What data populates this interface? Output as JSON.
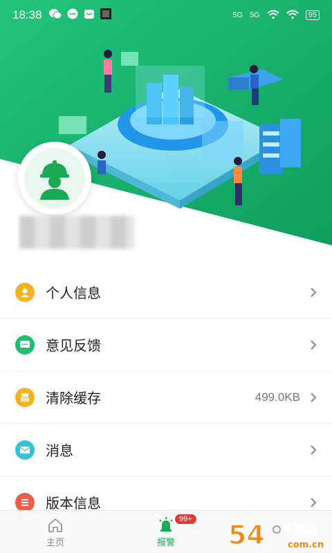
{
  "status_bar": {
    "time": "18:38",
    "signal1": "5G",
    "signal2": "5G",
    "battery": "95"
  },
  "menu": {
    "items": [
      {
        "label": "个人信息",
        "icon": "person-icon",
        "color": "#f5b324"
      },
      {
        "label": "意见反馈",
        "icon": "chat-bubble-icon",
        "color": "#1fbf6b"
      },
      {
        "label": "清除缓存",
        "icon": "broom-icon",
        "color": "#f5b324",
        "value": "499.0KB"
      },
      {
        "label": "消息",
        "icon": "mail-icon",
        "color": "#36c3d9"
      },
      {
        "label": "版本信息",
        "icon": "list-icon",
        "color": "#ef5b4f"
      }
    ]
  },
  "tabbar": {
    "home_label": "主页",
    "alarm_label": "报警",
    "alarm_badge": "99+"
  },
  "watermark": {
    "text1": "54",
    "text2": "手游网",
    "text3": "com.cn"
  },
  "colors": {
    "accent": "#1aaa55",
    "hero_start": "#1dbf73",
    "hero_end": "#0f9f5e"
  }
}
